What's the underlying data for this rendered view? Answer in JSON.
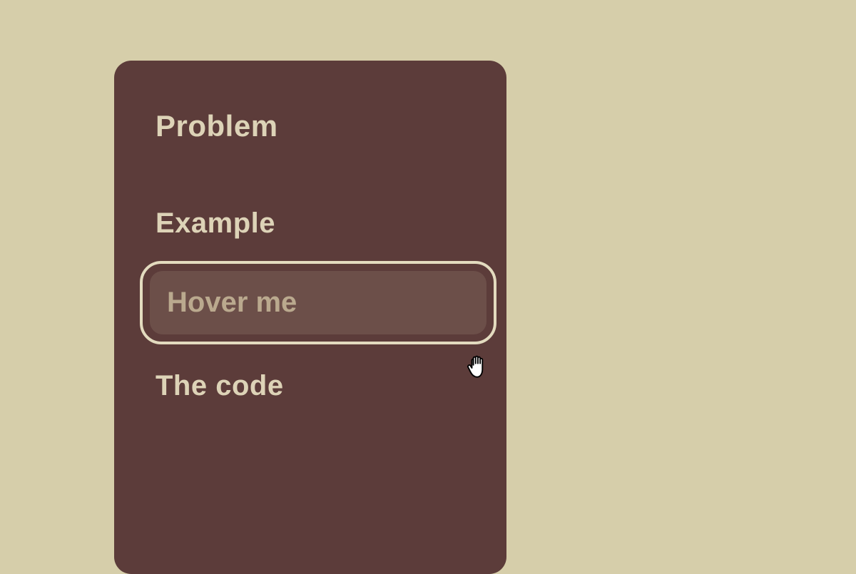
{
  "headings": {
    "problem": "Problem",
    "example": "Example",
    "code": "The code"
  },
  "hover_button": {
    "label": "Hover me"
  }
}
